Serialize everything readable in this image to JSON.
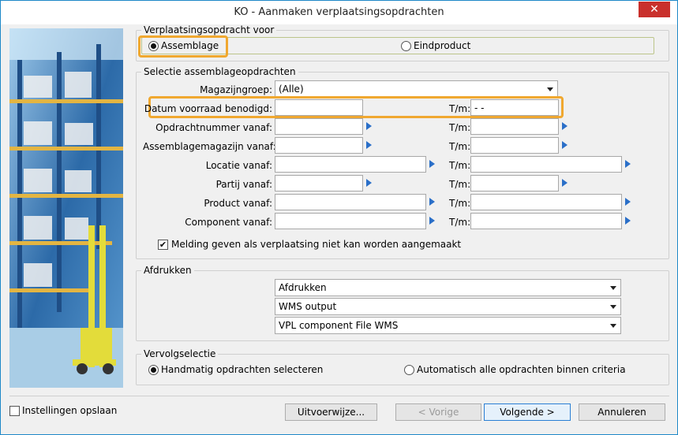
{
  "window": {
    "title": "KO - Aanmaken verplaatsingsopdrachten",
    "close_glyph": "✕"
  },
  "sections": {
    "type": {
      "legend": "Verplaatsingsopdracht voor",
      "options": [
        {
          "label": "Assemblage",
          "selected": true
        },
        {
          "label": "Eindproduct",
          "selected": false
        }
      ]
    },
    "selectie": {
      "legend": "Selectie assemblageopdrachten",
      "magazijngroep_label": "Magazijngroep:",
      "magazijngroep_value": "(Alle)",
      "tm_label": "T/m:",
      "rows": [
        {
          "label": "Datum voorraad benodigd:",
          "from": "",
          "to": " -  -"
        },
        {
          "label": "Opdrachtnummer vanaf:",
          "from": "",
          "to": ""
        },
        {
          "label": "Assemblagemagazijn vanaf:",
          "from": "",
          "to": ""
        },
        {
          "label": "Locatie vanaf:",
          "from": "",
          "to": ""
        },
        {
          "label": "Partij vanaf:",
          "from": "",
          "to": ""
        },
        {
          "label": "Product vanaf:",
          "from": "",
          "to": ""
        },
        {
          "label": "Component vanaf:",
          "from": "",
          "to": ""
        }
      ],
      "melding_label": "Melding geven als verplaatsing niet kan worden aangemaakt",
      "melding_checked": true
    },
    "afdrukken": {
      "legend": "Afdrukken",
      "dropdowns": [
        "Afdrukken",
        "WMS output",
        "VPL component File WMS"
      ]
    },
    "vervolg": {
      "legend": "Vervolgselectie",
      "options": [
        {
          "label": "Handmatig opdrachten selecteren",
          "selected": true
        },
        {
          "label": "Automatisch alle opdrachten binnen criteria",
          "selected": false
        }
      ]
    }
  },
  "footer": {
    "save_settings_label": "Instellingen opslaan",
    "buttons": {
      "uitvoer": "Uitvoerwijze...",
      "vorige": "< Vorige",
      "volgende": "Volgende >",
      "annuleren": "Annuleren"
    }
  },
  "colors": {
    "highlight": "#f0a830",
    "arrow": "#2a6fc8",
    "close": "#c9302c"
  }
}
